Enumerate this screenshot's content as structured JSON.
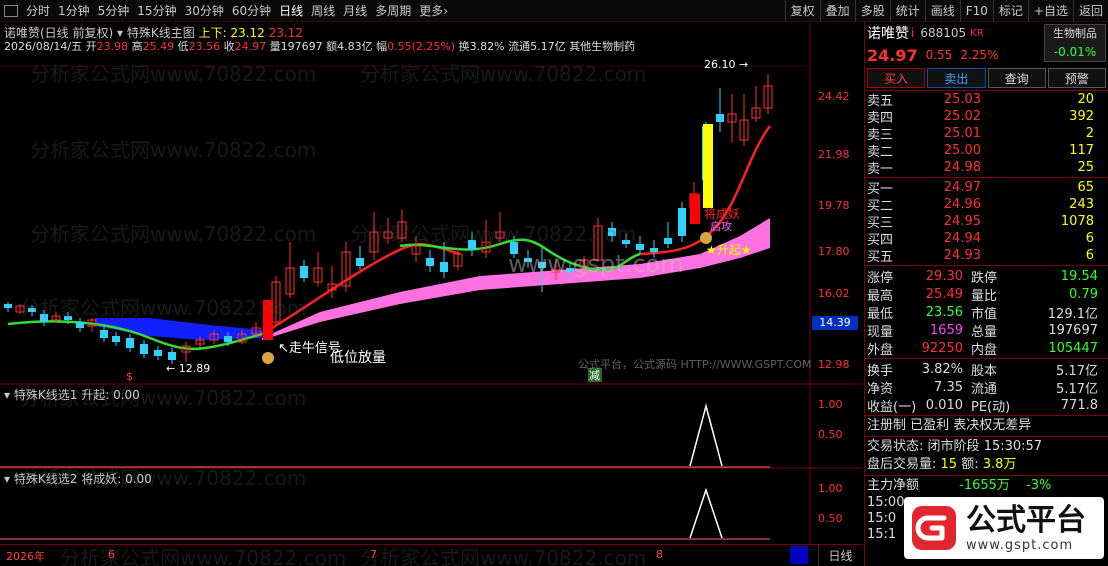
{
  "toolbar": {
    "periods": [
      "分时",
      "1分钟",
      "5分钟",
      "15分钟",
      "30分钟",
      "60分钟",
      "日线",
      "周线",
      "月线",
      "多周期",
      "更多"
    ],
    "more_arrow": "›",
    "right_items": [
      "复权",
      "叠加",
      "多股",
      "统计",
      "画线",
      "F10",
      "标记",
      "+自选",
      "返回"
    ]
  },
  "chart": {
    "title": "诺唯赞(日线 前复权)",
    "indicator_name": "特殊K线主图",
    "indicator_vals": "上下: 23.12",
    "indicator_vals2": "23.12",
    "info": {
      "date": "2026/08/14/五",
      "open_label": "开",
      "open": "23.98",
      "high_label": "高",
      "high": "25.49",
      "low_label": "低",
      "low": "23.56",
      "close_label": "收",
      "close": "24.97",
      "vol_label": "量",
      "vol": "197697",
      "amt_label": "额",
      "amt": "4.83亿",
      "amp_label": "幅",
      "amp": "0.55(2.25%)",
      "turn_label": "换",
      "turn": "3.82%",
      "float_label": "流通",
      "float": "5.17亿",
      "industry": "其他生物制药"
    },
    "price_axis": [
      "24.42",
      "21.98",
      "19.78",
      "17.80",
      "16.02",
      "14.39",
      "12.98"
    ],
    "current_price_box": "14.39",
    "high_annotation": "26.10",
    "low_annotation": "12.89",
    "labels": {
      "bull_signal": "走牛信号",
      "low_volume": "低位放量",
      "rise": "升起",
      "demon": "将成妖",
      "attack": "启攻",
      "reduce": "减",
      "dollar": "$"
    },
    "watermarks": [
      "分析家公式网www.70822.com",
      "公式平台，公式源码 HTTP://WWW.GSPT.COM",
      "www.gspt.com"
    ],
    "sub1": {
      "title": "特殊K线选1",
      "field": "升起",
      "value": "0.00",
      "axis": [
        "1.00",
        "0.50"
      ]
    },
    "sub2": {
      "title": "特殊K线选2",
      "field": "将成妖",
      "value": "0.00",
      "axis": [
        "1.00",
        "0.50"
      ]
    },
    "dates": [
      "2026年",
      "6",
      "7",
      "8"
    ],
    "period_btn": "日线"
  },
  "panel": {
    "name": "诺唯赞",
    "code": "688105",
    "tag": "KR",
    "sector": "生物制品",
    "sector_chg": "-0.01%",
    "price": "24.97",
    "change": "0.55",
    "change_pct": "2.25%",
    "buttons": [
      "买入",
      "卖出",
      "查询",
      "预警"
    ],
    "asks": [
      {
        "label": "卖五",
        "price": "25.03",
        "qty": "20"
      },
      {
        "label": "卖四",
        "price": "25.02",
        "qty": "392"
      },
      {
        "label": "卖三",
        "price": "25.01",
        "qty": "2"
      },
      {
        "label": "卖二",
        "price": "25.00",
        "qty": "117"
      },
      {
        "label": "卖一",
        "price": "24.98",
        "qty": "25"
      }
    ],
    "bids": [
      {
        "label": "买一",
        "price": "24.97",
        "qty": "65"
      },
      {
        "label": "买二",
        "price": "24.96",
        "qty": "243"
      },
      {
        "label": "买三",
        "price": "24.95",
        "qty": "1078"
      },
      {
        "label": "买四",
        "price": "24.94",
        "qty": "6"
      },
      {
        "label": "买五",
        "price": "24.93",
        "qty": "6"
      }
    ],
    "stats": [
      {
        "l1": "涨停",
        "v1": "29.30",
        "c1": "red",
        "l2": "跌停",
        "v2": "19.54",
        "c2": "green"
      },
      {
        "l1": "最高",
        "v1": "25.49",
        "c1": "red",
        "l2": "量比",
        "v2": "0.79",
        "c2": "green"
      },
      {
        "l1": "最低",
        "v1": "23.56",
        "c1": "green",
        "l2": "市值",
        "v2": "129.1亿",
        "c2": "white"
      },
      {
        "l1": "现量",
        "v1": "1659",
        "c1": "mag",
        "l2": "总量",
        "v2": "197697",
        "c2": "white"
      },
      {
        "l1": "外盘",
        "v1": "92250",
        "c1": "red",
        "l2": "内盘",
        "v2": "105447",
        "c2": "green"
      }
    ],
    "stats2": [
      {
        "l1": "换手",
        "v1": "3.82%",
        "c1": "white",
        "l2": "股本",
        "v2": "5.17亿",
        "c2": "white"
      },
      {
        "l1": "净资",
        "v1": "7.35",
        "c1": "white",
        "l2": "流通",
        "v2": "5.17亿",
        "c2": "white"
      },
      {
        "l1": "收益(一)",
        "v1": "0.010",
        "c1": "white",
        "l2": "PE(动)",
        "v2": "771.8",
        "c2": "white"
      }
    ],
    "reg": "注册制 已盈利 表决权无差异",
    "trade_state_label": "交易状态:",
    "trade_state": "闭市阶段",
    "trade_time": "15:30:57",
    "after_label": "盘后交易量:",
    "after_vol": "15",
    "after_amt_label": "额:",
    "after_amt": "3.8万",
    "main_flow_label": "主力净额",
    "main_flow": "-1655万",
    "main_flow_pct": "-3%",
    "times": [
      "15:00",
      "15:0",
      "15:1"
    ]
  },
  "logo": {
    "name": "公式平台",
    "url": "www.gspt.com"
  }
}
